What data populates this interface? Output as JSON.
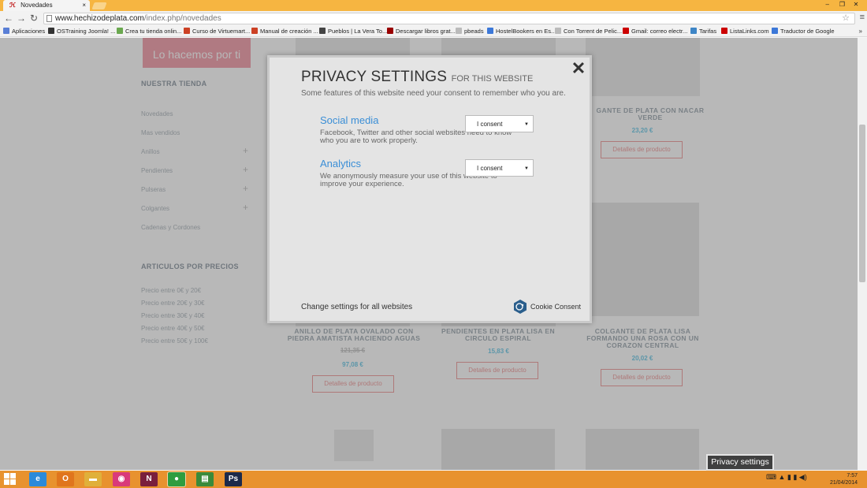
{
  "browser": {
    "tab_title": "Novedades",
    "tab_close": "×",
    "url_host": "www.hechizodeplata.com",
    "url_path": "/index.php/novedades",
    "window_controls": {
      "minimize": "–",
      "maximize": "❐",
      "close": "✕"
    },
    "nav": {
      "back": "←",
      "forward": "→",
      "reload": "↻"
    },
    "star": "☆",
    "menu": "≡"
  },
  "bookmarks": [
    {
      "label": "Aplicaciones",
      "color": "#5a7fd6"
    },
    {
      "label": "OSTraining Joomla! ...",
      "color": "#333333"
    },
    {
      "label": "Crea tu tienda onlin...",
      "color": "#6aa84f"
    },
    {
      "label": "Curso de Virtuemart...",
      "color": "#cc4125"
    },
    {
      "label": "Manual de creación ...",
      "color": "#cc4125"
    },
    {
      "label": "Pueblos | La Vera To...",
      "color": "#444444"
    },
    {
      "label": "Descargar libros grat...",
      "color": "#990000"
    },
    {
      "label": "pbeads",
      "color": "#bbbbbb"
    },
    {
      "label": "HostelBookers en Es...",
      "color": "#3c78d8"
    },
    {
      "label": "Con Torrent de Pelic...",
      "color": "#bbbbbb"
    },
    {
      "label": "Gmail: correo electr...",
      "color": "#cc0000"
    },
    {
      "label": "Tarifas",
      "color": "#3d85c6"
    },
    {
      "label": "ListaLinks.com",
      "color": "#cc0000"
    },
    {
      "label": "Traductor de Google",
      "color": "#3c78d8"
    }
  ],
  "bookmarks_more": "»",
  "sidebar": {
    "promo": "Lo hacemos por ti",
    "store_heading": "NUESTRA TIENDA",
    "categories": [
      "Novedades",
      "Mas vendidos",
      "Anillos",
      "Pendientes",
      "Pulseras",
      "Colgantes",
      "Cadenas y Cordones"
    ],
    "plus": "+",
    "price_heading": "ARTICULOS POR PRECIOS",
    "price_ranges": [
      "Precio entre 0€ y 20€",
      "Precio entre 20€ y 30€",
      "Precio entre 30€ y 40€",
      "Precio entre 40€ y 50€",
      "Precio entre 50€ y 100€"
    ]
  },
  "products": {
    "p1": {
      "title": "GANTE DE PLATA CON NACAR VERDE",
      "price": "23,20 €",
      "button": "Detalles de producto"
    },
    "p2": {
      "title": "ANILLO DE PLATA OVALADO CON PIEDRA AMATISTA HACIENDO AGUAS",
      "old_price": "121,35 €",
      "price": "97,08 €",
      "button": "Detalles de producto"
    },
    "p3": {
      "title": "PENDIENTES EN PLATA LISA EN CIRCULO ESPIRAL",
      "price": "15,83 €",
      "button": "Detalles de producto"
    },
    "p4": {
      "title": "COLGANTE DE PLATA LISA FORMANDO UNA ROSA CON UN CORAZON CENTRAL",
      "price": "20,02 €",
      "button": "Detalles de producto"
    }
  },
  "modal": {
    "title": "PRIVACY SETTINGS",
    "title_sub": "FOR THIS WEBSITE",
    "close": "✕",
    "description": "Some features of this website need your consent to remember who you are.",
    "categories": [
      {
        "name": "Social media",
        "description": "Facebook, Twitter and other social websites need to know who you are to work properly.",
        "selected": "I consent"
      },
      {
        "name": "Analytics",
        "description": "We anonymously measure your use of this website to improve your experience.",
        "selected": "I consent"
      }
    ],
    "footer_link": "Change settings for all websites",
    "brand": "Cookie Consent",
    "brand_color": "#2a5e8c"
  },
  "privacy_tab": "Privacy settings",
  "taskbar": {
    "apps": [
      {
        "label": "e",
        "color": "#2b8ad9"
      },
      {
        "label": "O",
        "color": "#e0751d"
      },
      {
        "label": "▬",
        "color": "#e0b03a"
      },
      {
        "label": "◉",
        "color": "#d93a7a"
      },
      {
        "label": "N",
        "color": "#7a1f3d"
      },
      {
        "label": "●",
        "color": "#2f9d3f"
      },
      {
        "label": "▤",
        "color": "#3a8a3a"
      },
      {
        "label": "Ps",
        "color": "#1c2a4a"
      }
    ],
    "time": "7:57",
    "date": "21/04/2014",
    "tray": "⌨ ▲ ▮ ▮ ◀)"
  }
}
